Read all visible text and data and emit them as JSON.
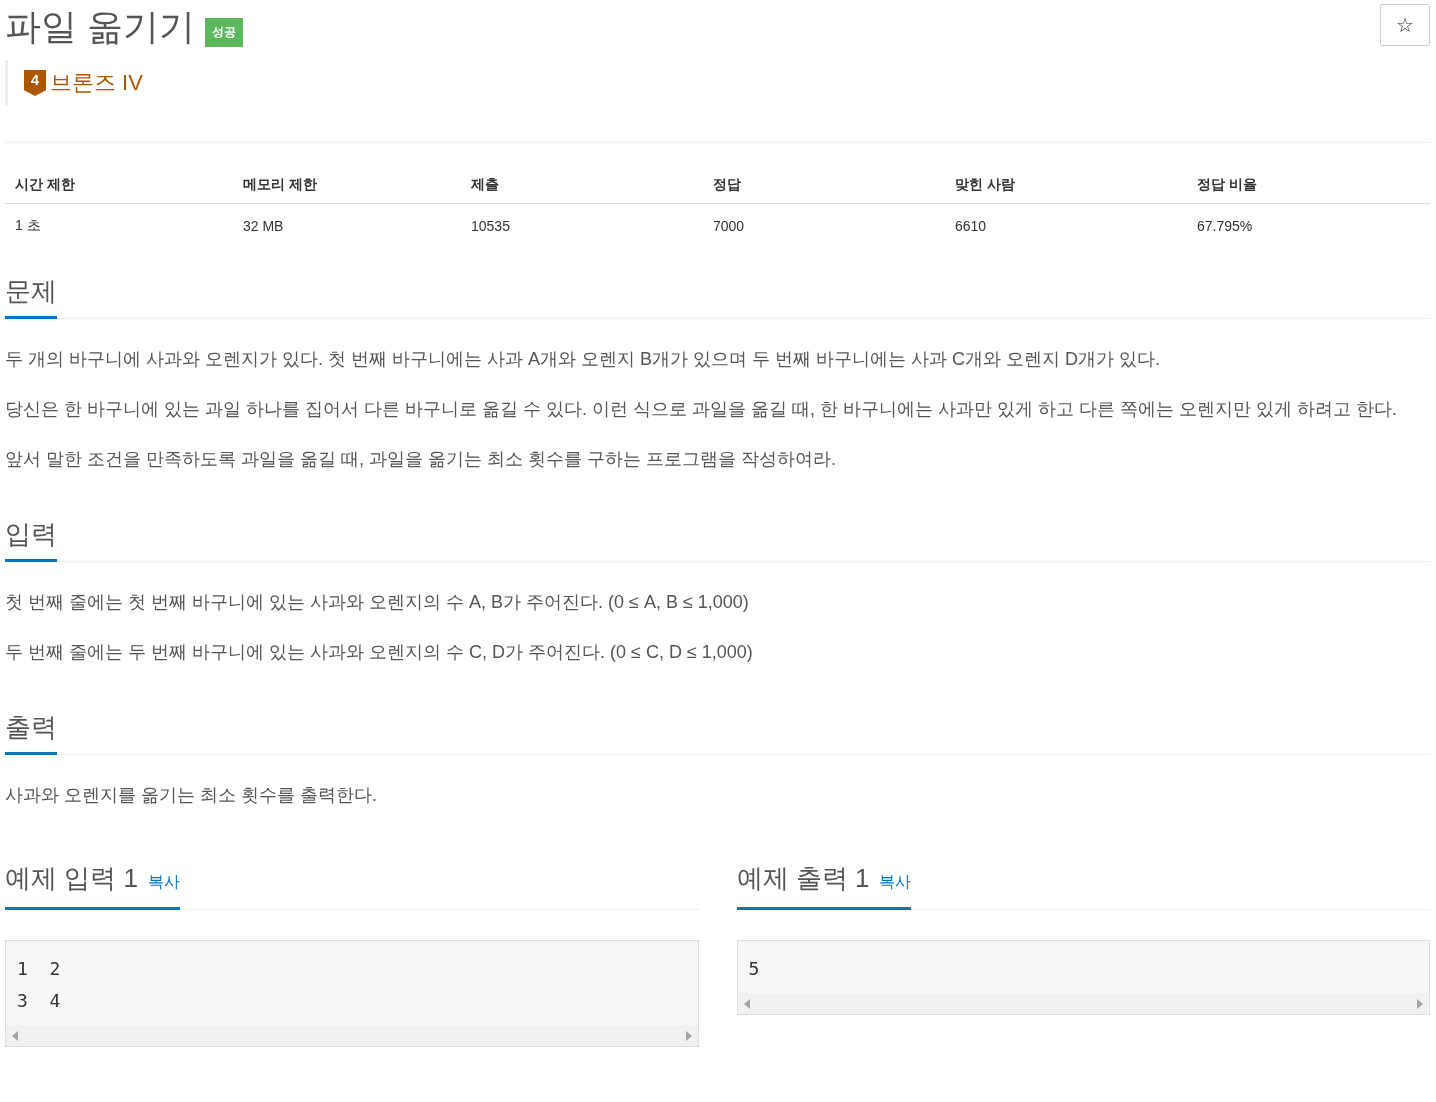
{
  "title": "파일 옮기기",
  "result_badge": "성공",
  "star_button": "☆",
  "tier": {
    "number": "4",
    "name": "브론즈 IV"
  },
  "stats": {
    "columns": [
      "시간 제한",
      "메모리 제한",
      "제출",
      "정답",
      "맞힌 사람",
      "정답 비율"
    ],
    "rows": [
      [
        "1 초",
        "32 MB",
        "10535",
        "7000",
        "6610",
        "67.795%"
      ]
    ]
  },
  "sections": [
    {
      "heading": "문제",
      "paragraphs": [
        "두 개의 바구니에 사과와 오렌지가 있다. 첫 번째 바구니에는 사과 A개와 오렌지 B개가 있으며 두 번째 바구니에는 사과 C개와 오렌지 D개가 있다.",
        "당신은 한 바구니에 있는 과일 하나를 집어서 다른 바구니로 옮길 수 있다. 이런 식으로 과일을 옮길 때, 한 바구니에는 사과만 있게 하고 다른 쪽에는 오렌지만 있게 하려고 한다.",
        "앞서 말한 조건을 만족하도록 과일을 옮길 때, 과일을 옮기는 최소 횟수를 구하는 프로그램을 작성하여라."
      ]
    },
    {
      "heading": "입력",
      "paragraphs": [
        "첫 번째 줄에는 첫 번째 바구니에 있는 사과와 오렌지의 수 A, B가 주어진다. (0 ≤ A, B ≤ 1,000)",
        "두 번째 줄에는 두 번째 바구니에 있는 사과와 오렌지의 수 C, D가 주어진다. (0 ≤ C, D ≤ 1,000)"
      ]
    },
    {
      "heading": "출력",
      "paragraphs": [
        "사과와 오렌지를 옮기는 최소 횟수를 출력한다."
      ]
    }
  ],
  "samples": [
    {
      "heading": "예제 입력 1",
      "copy_link": "복사",
      "lines": [
        "1 2",
        "3 4"
      ]
    },
    {
      "heading": "예제 출력 1",
      "copy_link": "복사",
      "lines": [
        "5"
      ]
    }
  ]
}
